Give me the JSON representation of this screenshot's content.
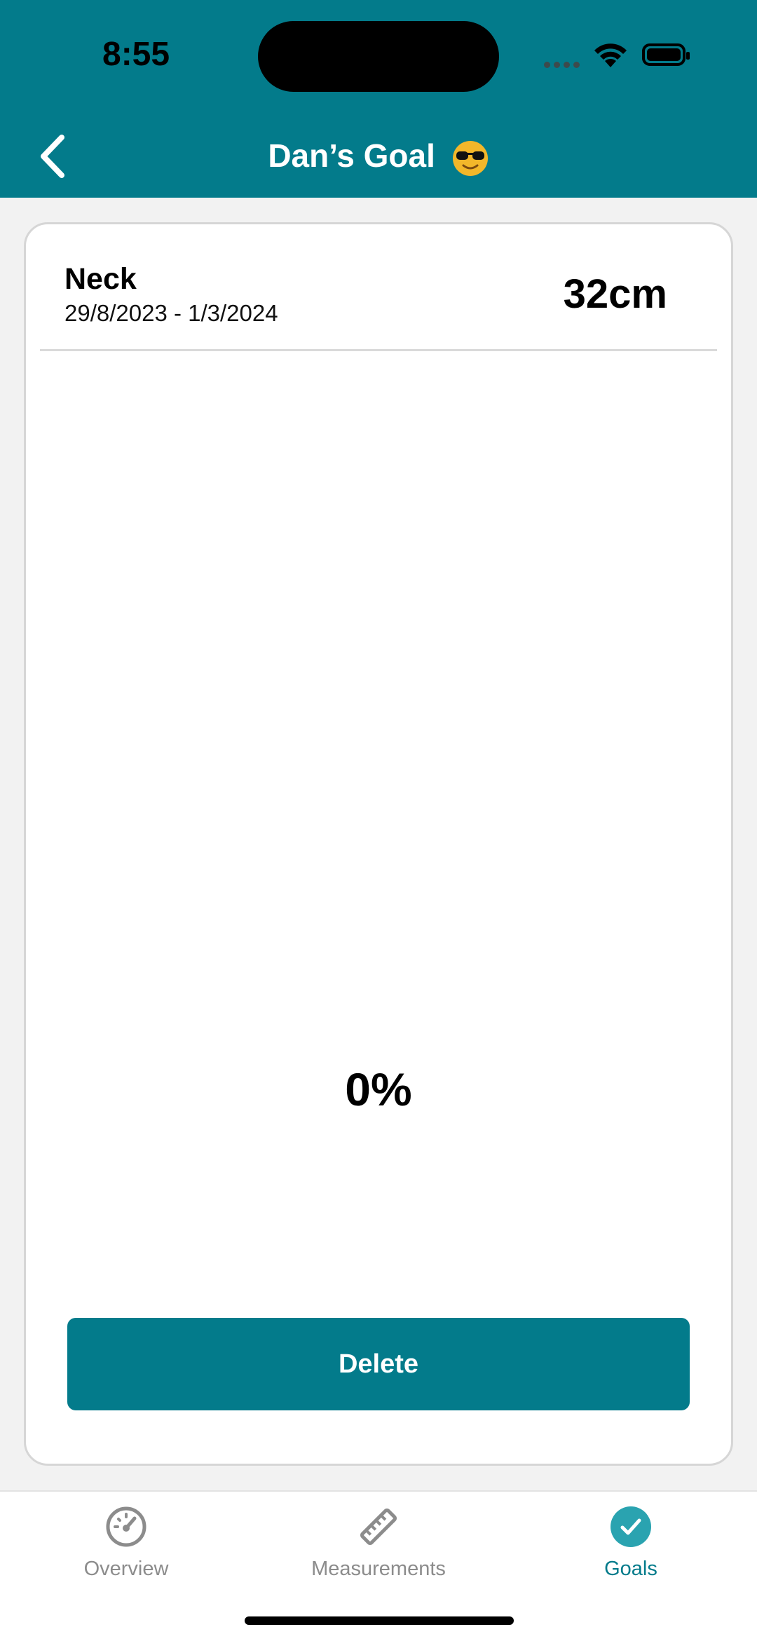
{
  "status_bar": {
    "time": "8:55"
  },
  "header": {
    "title": "Dan’s Goal"
  },
  "goal": {
    "name": "Neck",
    "date_range": "29/8/2023 - 1/3/2024",
    "target": "32cm",
    "progress": "0%"
  },
  "actions": {
    "delete_label": "Delete"
  },
  "tab_bar": {
    "tabs": [
      {
        "label": "Overview",
        "icon": "speedometer-icon"
      },
      {
        "label": "Measurements",
        "icon": "ruler-icon"
      },
      {
        "label": "Goals",
        "icon": "checkmark-circle-icon",
        "active": true
      }
    ]
  },
  "colors": {
    "brand": "#037b8b",
    "inactive_tab": "#8c8c8c"
  }
}
